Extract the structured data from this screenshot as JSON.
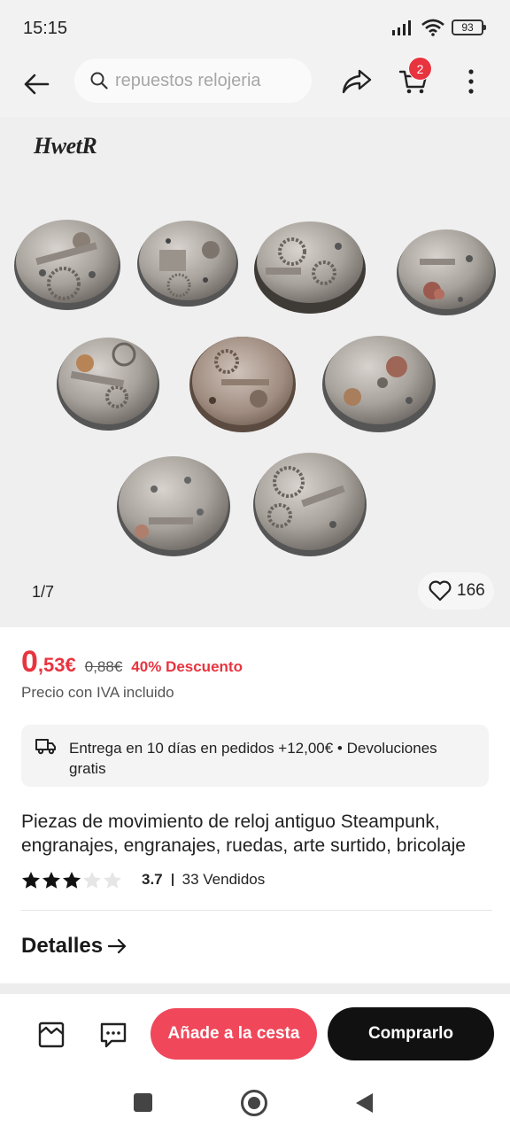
{
  "status_bar": {
    "time": "15:15",
    "battery": "93"
  },
  "header": {
    "search_placeholder": "repuestos relojeria",
    "cart_count": "2",
    "icons": [
      "back-arrow-icon",
      "search-icon",
      "share-icon",
      "cart-icon",
      "more-vertical-icon"
    ]
  },
  "gallery": {
    "brand": "HwetR",
    "counter": "1/7",
    "favorites": "166"
  },
  "price": {
    "integer": "0",
    "decimals": ",53€",
    "original": "0,88€",
    "discount": "40% Descuento",
    "tax_note": "Precio con IVA incluido",
    "accent_color": "#e8343f"
  },
  "delivery": {
    "text": "Entrega en 10 días en pedidos +12,00€ • Devoluciones gratis"
  },
  "product": {
    "title": "Piezas de movimiento de reloj antiguo Steampunk, engranajes, engranajes, ruedas, arte surtido, bricolaje",
    "rating": "3.7",
    "rating_value": 3.7,
    "rating_max": 5,
    "sold": "33 Vendidos"
  },
  "details": {
    "label": "Detalles"
  },
  "actions": {
    "add_to_cart": "Añade a la cesta",
    "buy": "Comprarlo"
  }
}
